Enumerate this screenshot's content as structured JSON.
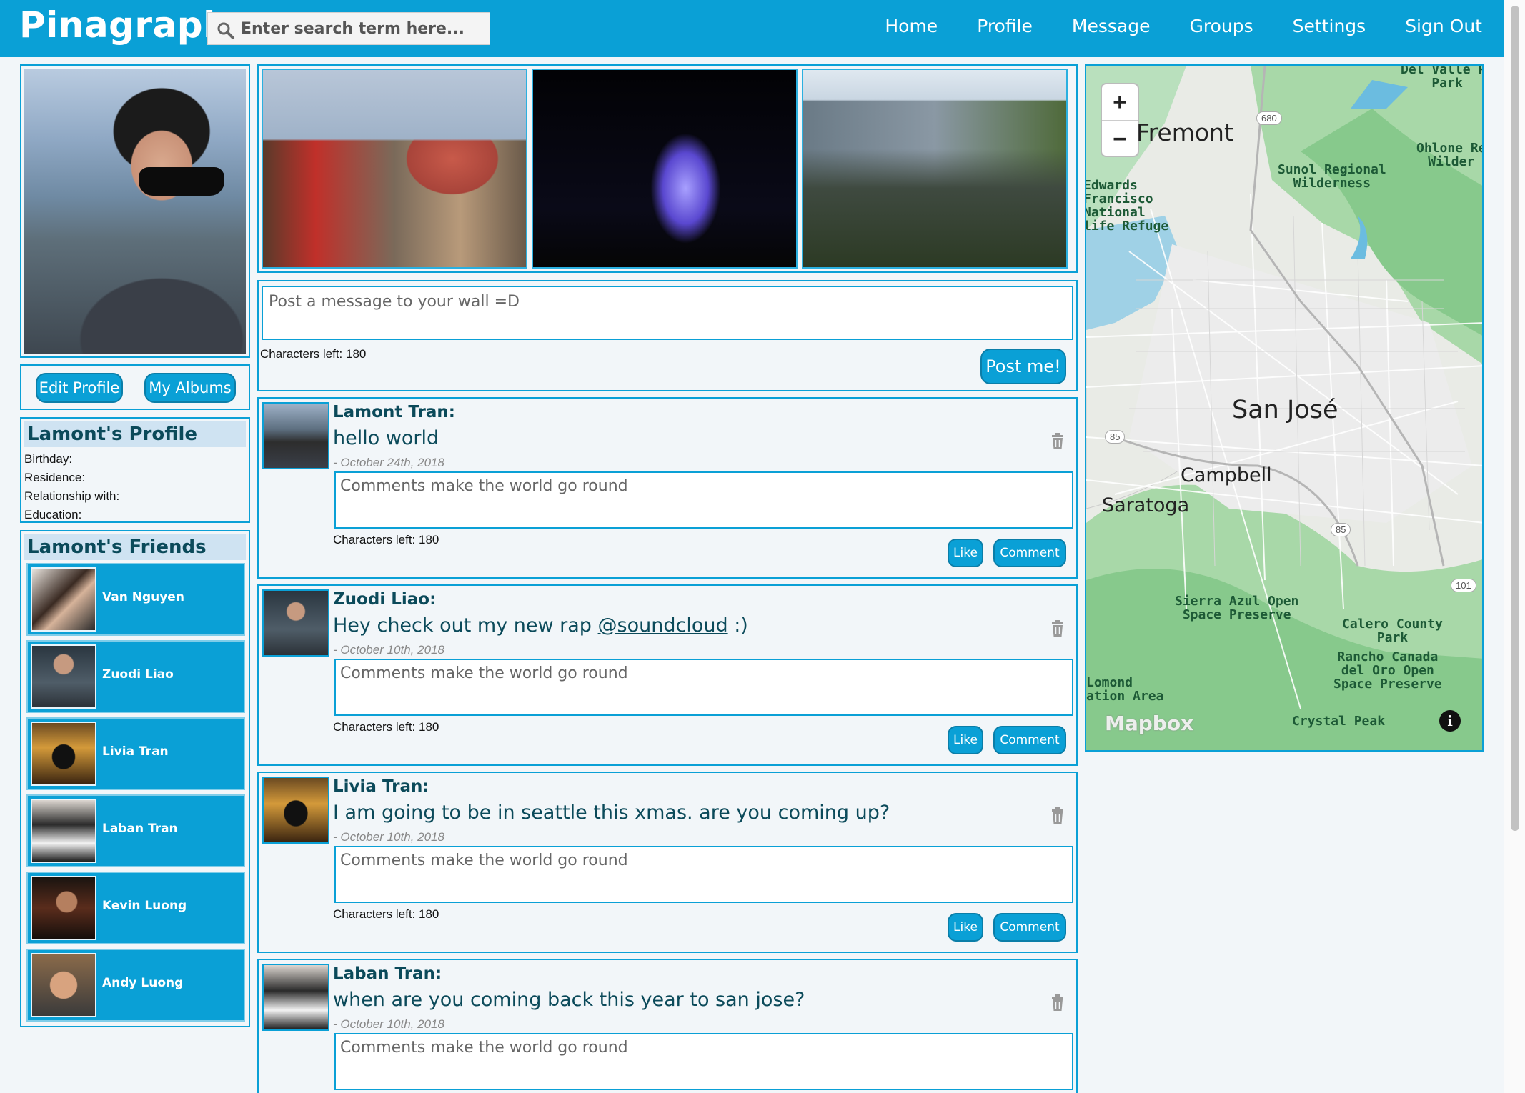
{
  "header": {
    "brand": "Pinagraph",
    "search_placeholder": "Enter search term here...",
    "nav": [
      "Home",
      "Profile",
      "Message",
      "Groups",
      "Settings",
      "Sign Out"
    ],
    "accent_color": "#0aa0d6"
  },
  "sidebar": {
    "edit_profile_label": "Edit Profile",
    "my_albums_label": "My Albums",
    "profile": {
      "title": "Lamont's Profile",
      "fields": [
        "Birthday:",
        "Residence:",
        "Relationship with:",
        "Education:"
      ]
    },
    "friends": {
      "title": "Lamont's Friends",
      "list": [
        "Van Nguyen",
        "Zuodi Liao",
        "Livia Tran",
        "Laban Tran",
        "Kevin Luong",
        "Andy Luong"
      ]
    }
  },
  "composer": {
    "placeholder": "Post a message to your wall =D",
    "chars_left": "Characters left: 180",
    "post_label": "Post me!"
  },
  "posts": [
    {
      "author": "Lamont Tran:",
      "message": "hello world",
      "date": "- October 24th, 2018",
      "comment_placeholder": "Comments make the world go round",
      "chars_left": "Characters left: 180",
      "like_label": "Like",
      "comment_label": "Comment"
    },
    {
      "author": "Zuodi Liao:",
      "message_prefix": "Hey check out my new rap ",
      "message_link": "@soundcloud",
      "message_suffix": " :)",
      "date": "- October 10th, 2018",
      "comment_placeholder": "Comments make the world go round",
      "chars_left": "Characters left: 180",
      "like_label": "Like",
      "comment_label": "Comment"
    },
    {
      "author": "Livia Tran:",
      "message": "I am going to be in seattle this xmas. are you coming up?",
      "date": "- October 10th, 2018",
      "comment_placeholder": "Comments make the world go round",
      "chars_left": "Characters left: 180",
      "like_label": "Like",
      "comment_label": "Comment"
    },
    {
      "author": "Laban Tran:",
      "message": "when are you coming back this year to san jose?",
      "date": "- October 10th, 2018",
      "comment_placeholder": "Comments make the world go round"
    }
  ],
  "map": {
    "zoom_in": "+",
    "zoom_out": "−",
    "cities": [
      "Fremont",
      "San José",
      "Campbell",
      "Saratoga"
    ],
    "parks": [
      "Del Valle Re\nPark",
      "Sunol Regional\nWilderness",
      "Ohlone Re\nWilder",
      "Edwards\nFrancisco\nNational\nlife Refuge",
      "Sierra Azul Open\nSpace Preserve",
      "Calero County\nPark",
      "Rancho Canada\ndel Oro Open\nSpace Preserve",
      "Lomond\nation Area",
      "Crystal Peak"
    ],
    "highways": [
      "680",
      "85",
      "85",
      "101"
    ],
    "attribution": "Mapbox",
    "info_icon": "i"
  }
}
